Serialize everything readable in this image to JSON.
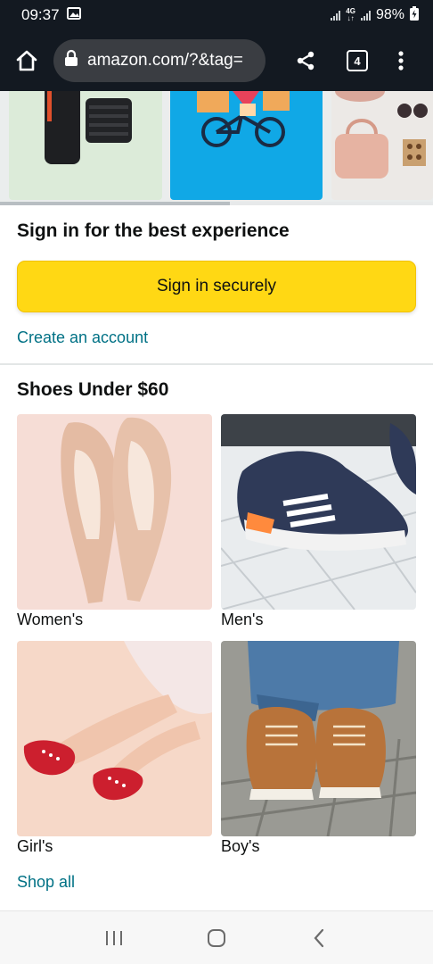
{
  "status_bar": {
    "time": "09:37",
    "network": "4G",
    "battery": "98%"
  },
  "browser": {
    "url": "amazon.com/?&tag=",
    "tab_count": "4"
  },
  "carousel": {
    "progress": 0.53
  },
  "signin": {
    "title": "Sign in for the best experience",
    "button_label": "Sign in securely",
    "create_account_label": "Create an account"
  },
  "shoes": {
    "title": "Shoes Under $60",
    "tiles": [
      {
        "label": "Women's"
      },
      {
        "label": "Men's"
      },
      {
        "label": "Girl's"
      },
      {
        "label": "Boy's"
      }
    ],
    "shop_all_label": "Shop all"
  },
  "colors": {
    "header_bg": "#131921",
    "signin_button": "#FFD814",
    "link": "#007185"
  }
}
